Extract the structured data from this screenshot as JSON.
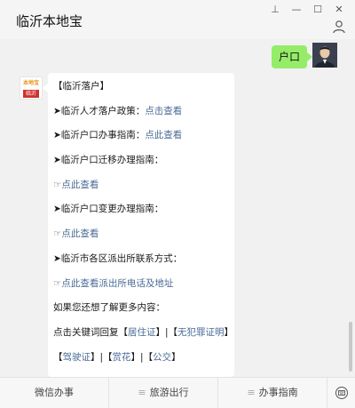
{
  "window": {
    "title": "临沂本地宝",
    "pin_glyph": "⊥",
    "min_glyph": "—",
    "max_glyph": "☐",
    "close_glyph": "✕"
  },
  "chat": {
    "user_message": "户口",
    "bot_avatar": {
      "brand_top": "本地宝",
      "brand_city": "临沂"
    },
    "bot_lines": [
      {
        "text": "【临沂落户】"
      },
      {
        "prefix": "➤临沂人才落户政策：",
        "link": "点击查看"
      },
      {
        "prefix": "➤临沂户口办事指南：",
        "link": "点此查看"
      },
      {
        "prefix": "➤临沂户口迁移办理指南：",
        "link": ""
      },
      {
        "prefix": "☞",
        "link": "点此查看"
      },
      {
        "prefix": "➤临沂户口变更办理指南：",
        "link": ""
      },
      {
        "prefix": "☞",
        "link": "点此查看"
      },
      {
        "prefix": "➤临沂市各区派出所联系方式：",
        "link": ""
      },
      {
        "prefix": "☞",
        "link": "点此查看派出所电话及地址"
      },
      {
        "text": "如果您还想了解更多内容："
      },
      {
        "prefix": "点击关键词回复【",
        "link": "居住证",
        "mid": "】|【",
        "link2": "无犯罪证明",
        "suffix": "】"
      },
      {
        "prefix": "【",
        "link": "驾驶证",
        "mid": "】|【",
        "link2": "赏花",
        "mid2": "】|【",
        "link3": "公交",
        "suffix": "】"
      }
    ]
  },
  "menu": {
    "items": [
      "微信办事",
      "旅游出行",
      "办事指南"
    ],
    "bars_glyph": "≡"
  },
  "colors": {
    "link": "#4a6b96",
    "user_bubble": "#95ec69"
  }
}
